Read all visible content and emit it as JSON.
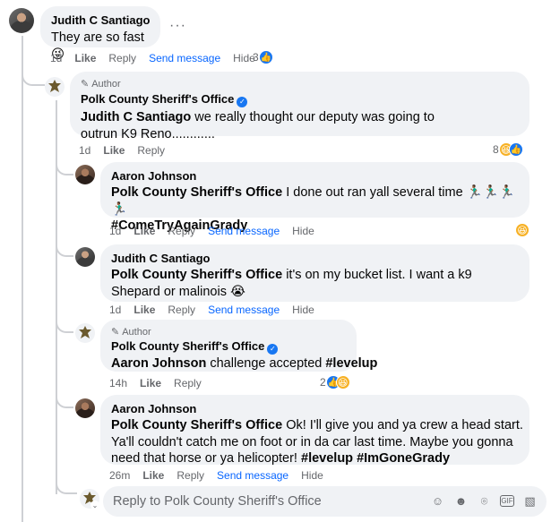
{
  "comments": [
    {
      "name": "Judith C Santiago",
      "text": "They are so fast",
      "emoji": "😜",
      "more": "···",
      "actions": {
        "time": "1d",
        "like": "Like",
        "reply": "Reply",
        "send": "Send message",
        "hide": "Hide"
      },
      "reactions": {
        "count": "3",
        "types": [
          "like"
        ]
      }
    },
    {
      "author_badge": "Author",
      "name": "Polk County Sheriff's Office",
      "verified": true,
      "mention": "Judith C Santiago",
      "text": " we really thought our deputy was going to outrun K9 Reno............",
      "actions": {
        "time": "1d",
        "like": "Like",
        "reply": "Reply"
      },
      "reactions": {
        "count": "8",
        "types": [
          "haha",
          "like"
        ]
      }
    },
    {
      "name": "Aaron Johnson",
      "mention": "Polk County Sheriff's Office",
      "text": " I done out ran yall several time 🏃🏾‍♂️🏃🏾‍♂️🏃🏾‍♂️🏃🏾‍♂️",
      "hashtag": "#ComeTryAgainGrady",
      "actions": {
        "time": "1d",
        "like": "Like",
        "reply": "Reply",
        "send": "Send message",
        "hide": "Hide"
      },
      "reactions": {
        "types": [
          "haha"
        ]
      }
    },
    {
      "name": "Judith C Santiago",
      "mention": "Polk County Sheriff's Office",
      "text": " it's on my bucket list. I want a k9 Shepard or malinois",
      "emoji": "😭",
      "actions": {
        "time": "1d",
        "like": "Like",
        "reply": "Reply",
        "send": "Send message",
        "hide": "Hide"
      }
    },
    {
      "author_badge": "Author",
      "name": "Polk County Sheriff's Office",
      "verified": true,
      "mention": "Aaron Johnson",
      "text": " challenge accepted ",
      "hashtag": "#levelup",
      "actions": {
        "time": "14h",
        "like": "Like",
        "reply": "Reply"
      },
      "reactions": {
        "count": "2",
        "types": [
          "like",
          "haha"
        ]
      }
    },
    {
      "name": "Aaron Johnson",
      "mention": "Polk County Sheriff's Office",
      "text": " Ok! I'll give you and ya crew a head start. Ya'll couldn't catch me on foot or in da car last time. Maybe you gonna need that horse or ya helicopter! ",
      "hashtag1": "#levelup",
      "hashtag2": "#ImGoneGrady",
      "actions": {
        "time": "26m",
        "like": "Like",
        "reply": "Reply",
        "send": "Send message",
        "hide": "Hide"
      }
    }
  ],
  "reply_box": {
    "placeholder": "Reply to Polk County Sheriff's Office",
    "icons": [
      "avatar-sticker-icon",
      "emoji-icon",
      "camera-icon",
      "gif-icon",
      "sticker-icon"
    ]
  }
}
